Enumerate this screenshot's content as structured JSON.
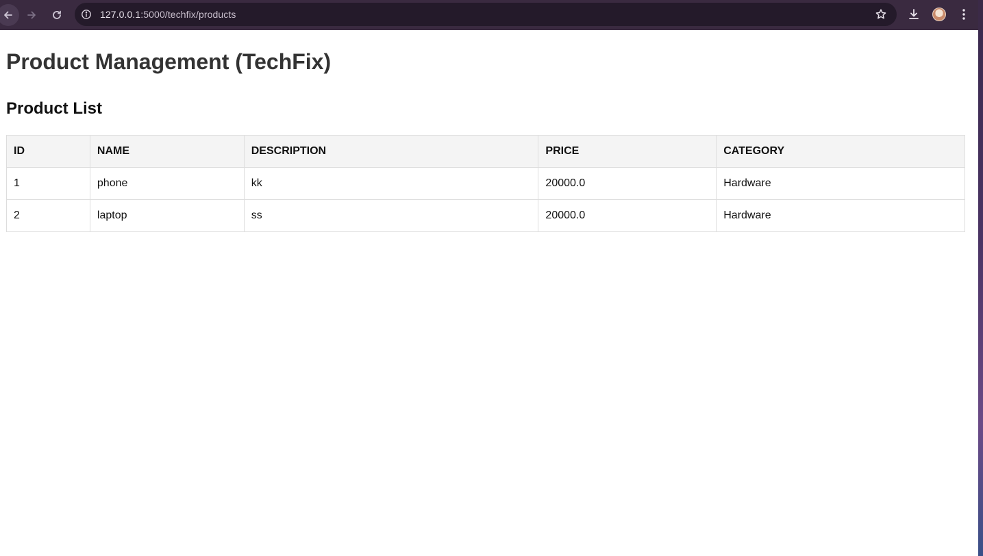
{
  "browser": {
    "url_host": "127.0.0.1",
    "url_path": ":5000/techfix/products",
    "icons": [
      "back-arrow-icon",
      "forward-arrow-icon",
      "reload-icon",
      "info-icon",
      "star-icon",
      "download-icon",
      "avatar",
      "more-menu-icon"
    ]
  },
  "page": {
    "title": "Product Management (TechFix)",
    "section_title": "Product List"
  },
  "table": {
    "headers": [
      "ID",
      "NAME",
      "DESCRIPTION",
      "PRICE",
      "CATEGORY"
    ],
    "rows": [
      [
        "1",
        "phone",
        "kk",
        "20000.0",
        "Hardware"
      ],
      [
        "2",
        "laptop",
        "ss",
        "20000.0",
        "Hardware"
      ]
    ]
  }
}
